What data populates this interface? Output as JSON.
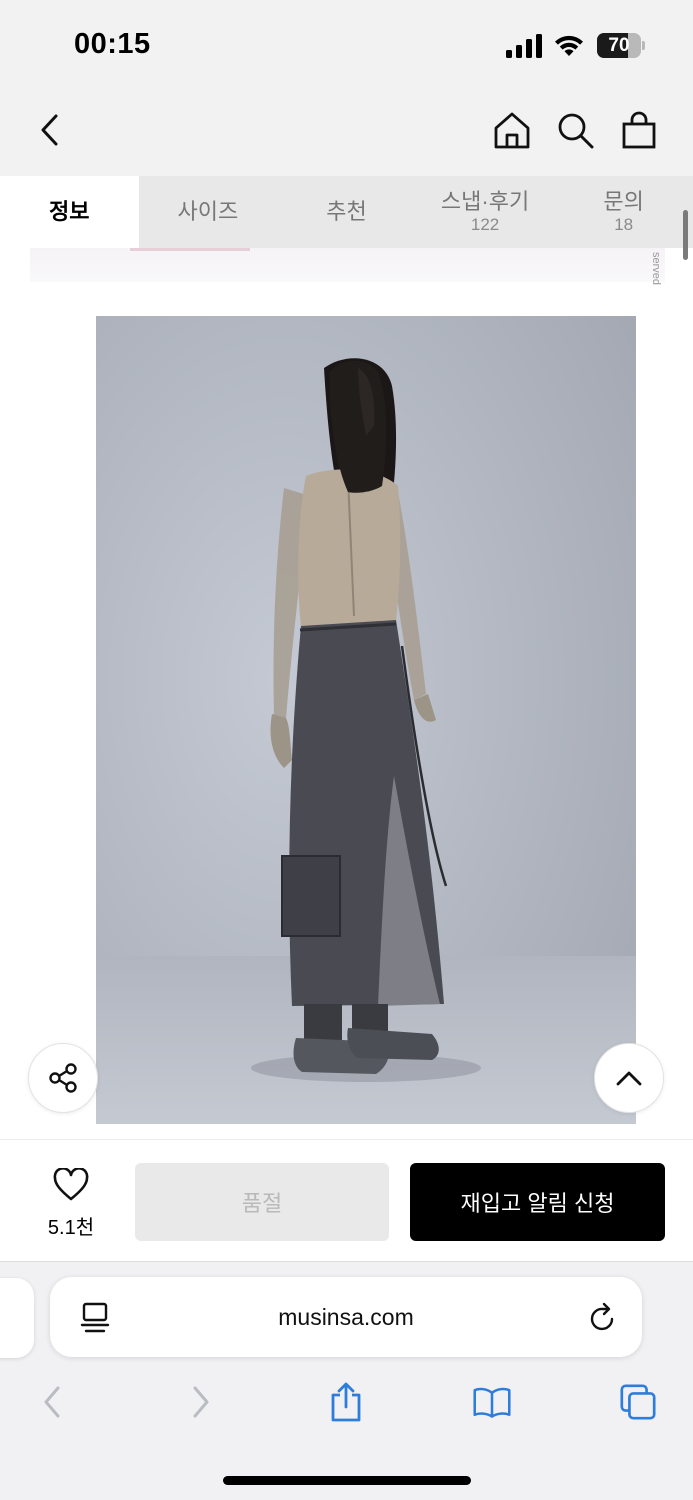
{
  "status": {
    "time": "00:15",
    "battery_level": "70",
    "battery_fraction": 0.7
  },
  "header": {
    "icons": [
      "back-chevron-icon",
      "home-icon",
      "search-icon",
      "shopping-bag-icon"
    ]
  },
  "tabs": [
    {
      "label": "정보",
      "count": "",
      "active": true
    },
    {
      "label": "사이즈",
      "count": "",
      "active": false
    },
    {
      "label": "추천",
      "count": "",
      "active": false
    },
    {
      "label": "스냅·후기",
      "count": "122",
      "active": false
    },
    {
      "label": "문의",
      "count": "18",
      "active": false
    }
  ],
  "content": {
    "partial_text": "served",
    "photo_subject": "product-model-photo"
  },
  "floating": {
    "share_icon": "share-icon",
    "top_icon": "chevron-up-icon"
  },
  "purchase": {
    "like_count": "5.1천",
    "soldout_label": "품절",
    "restock_label": "재입고 알림 신청"
  },
  "browser": {
    "url": "musinsa.com",
    "toolbar_icons": [
      "back-icon",
      "forward-icon",
      "share-icon",
      "bookmarks-icon",
      "tabs-icon"
    ]
  },
  "colors": {
    "primary": "#000000",
    "disabled_bg": "#e9e9e9",
    "disabled_text": "#b9b9b9",
    "safari_blue": "#2f7ddb"
  }
}
